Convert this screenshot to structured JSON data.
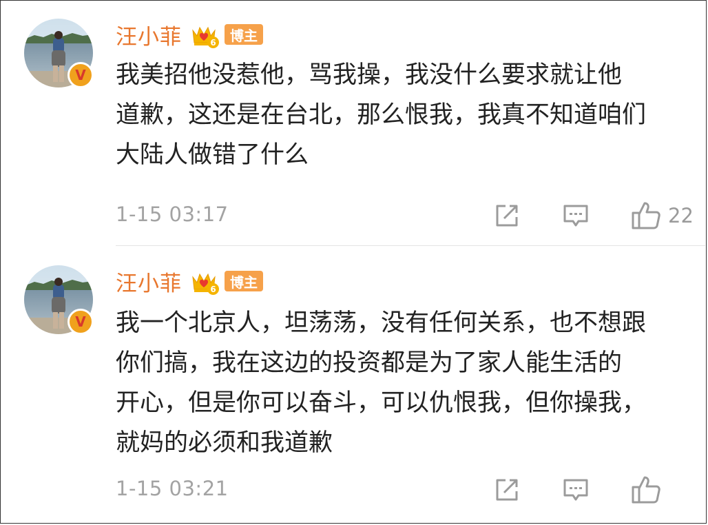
{
  "comments": [
    {
      "username": "汪小菲",
      "level": "6",
      "role_tag": "博主",
      "verified_mark": "V",
      "text_lines": [
        "我美招他没惹他，骂我操，我没什么要求就让他",
        "道歉，这还是在台北，那么恨我，我真不知道咱们",
        "大陆人做错了什么"
      ],
      "timestamp": "1-15 03:17",
      "like_count": "22",
      "icons": [
        "share-icon",
        "reply-icon",
        "like-icon"
      ]
    },
    {
      "username": "汪小菲",
      "level": "6",
      "role_tag": "博主",
      "verified_mark": "V",
      "text_lines": [
        "我一个北京人，坦荡荡，没有任何关系，也不想跟",
        "你们搞，我在这边的投资都是为了家人能生活的",
        "开心，但是你可以奋斗，可以仇恨我，但你操我，",
        "就妈的必须和我道歉"
      ],
      "timestamp": "1-15 03:21",
      "like_count": "",
      "icons": [
        "share-icon",
        "reply-icon",
        "like-icon"
      ]
    }
  ],
  "colors": {
    "username": "#e8772e",
    "role_tag_bg": "#f6a14a",
    "verified_badge": "#f0a11d",
    "meta_text": "#a3a3a3"
  }
}
